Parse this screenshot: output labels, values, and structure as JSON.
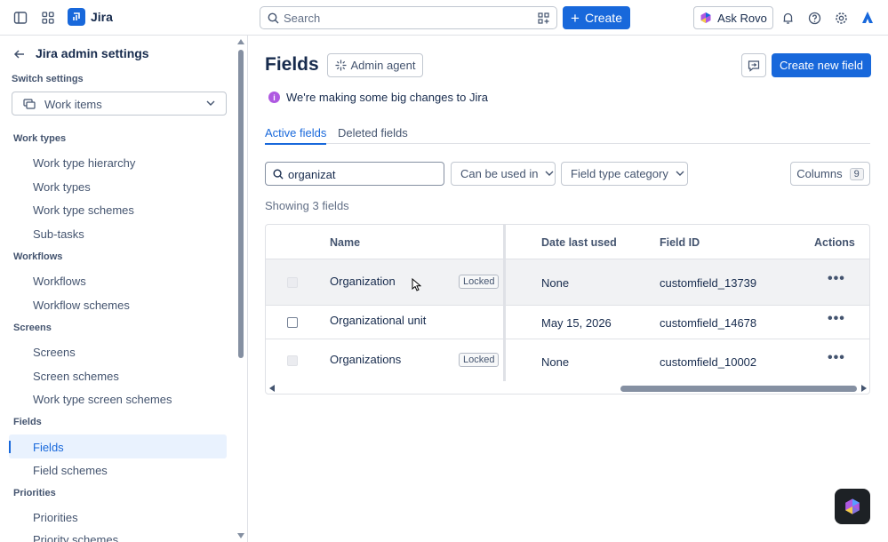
{
  "topbar": {
    "app_name": "Jira",
    "search_placeholder": "Search",
    "create_label": "Create",
    "rovo_label": "Ask Rovo"
  },
  "sidebar": {
    "title": "Jira admin settings",
    "switch_label": "Switch settings",
    "switch_value": "Work items",
    "sections": [
      {
        "label": "Work types",
        "items": [
          "Work type hierarchy",
          "Work types",
          "Work type schemes",
          "Sub-tasks"
        ]
      },
      {
        "label": "Workflows",
        "items": [
          "Workflows",
          "Workflow schemes"
        ]
      },
      {
        "label": "Screens",
        "items": [
          "Screens",
          "Screen schemes",
          "Work type screen schemes"
        ]
      },
      {
        "label": "Fields",
        "items": [
          "Fields",
          "Field schemes"
        ]
      },
      {
        "label": "Priorities",
        "items": [
          "Priorities",
          "Priority schemes"
        ]
      }
    ],
    "active_item": "Fields"
  },
  "main": {
    "title": "Fields",
    "agent_label": "Admin agent",
    "new_field_label": "Create new field",
    "info_text": "We're making some big changes to Jira",
    "tabs": [
      {
        "label": "Active fields",
        "active": true
      },
      {
        "label": "Deleted fields",
        "active": false
      }
    ],
    "filter_value": "organizat",
    "filters": [
      "Can be used in",
      "Field type category"
    ],
    "columns_label": "Columns",
    "columns_count": "9",
    "showing": "Showing 3 fields",
    "table": {
      "headers": [
        "Name",
        "Date last used",
        "Field ID",
        "Actions"
      ],
      "rows": [
        {
          "name": "Organization",
          "locked": "Locked",
          "date": "None",
          "id": "customfield_13739"
        },
        {
          "name": "Organizational unit",
          "locked": "",
          "date": "May 15, 2026",
          "id": "customfield_14678"
        },
        {
          "name": "Organizations",
          "locked": "Locked",
          "date": "None",
          "id": "customfield_10002"
        }
      ]
    }
  },
  "colors": {
    "primary": "#1868db",
    "info": "#af59e1"
  }
}
